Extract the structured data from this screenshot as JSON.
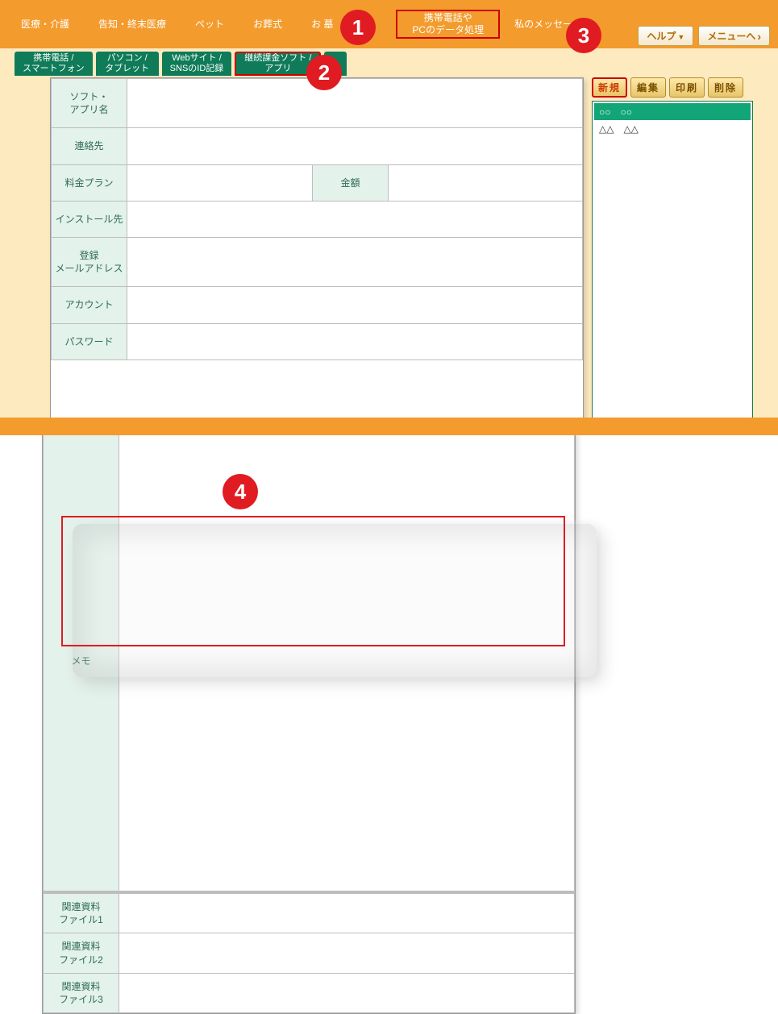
{
  "top_nav": [
    "医療・介護",
    "告知・終末医療",
    "ペット",
    "お葬式",
    "お 墓",
    "",
    "携帯電話や\nPCのデータ処理",
    "私のメッセージ"
  ],
  "top_nav_highlight_index": 6,
  "top_buttons": {
    "help": "ヘルプ",
    "menu": "メニューへ"
  },
  "tabs": [
    {
      "label": "携帯電話 /\nスマートフォン"
    },
    {
      "label": "パソコン /\nタブレット"
    },
    {
      "label": "Webサイト /\nSNSのID記録"
    },
    {
      "label": "継続課金ソフト /\nアプリ",
      "active": true
    },
    {
      "label": "",
      "stub": true
    }
  ],
  "form_labels": {
    "name": "ソフト・\nアプリ名",
    "contact": "連絡先",
    "plan": "料金プラン",
    "amount": "金額",
    "install": "インストール先",
    "email": "登録\nメールアドレス",
    "account": "アカウント",
    "password": "パスワード",
    "memo": "メモ",
    "rel1": "関連資料\nファイル1",
    "rel2": "関連資料\nファイル2",
    "rel3": "関連資料\nファイル3"
  },
  "side_buttons": {
    "new": "新規",
    "edit": "編集",
    "print": "印刷",
    "delete": "削除"
  },
  "side_list": [
    {
      "text": "○○　○○",
      "selected": true
    },
    {
      "text": "△△　△△",
      "selected": false
    }
  ],
  "callouts": {
    "1": "1",
    "2": "2",
    "3": "3",
    "4": "4"
  }
}
